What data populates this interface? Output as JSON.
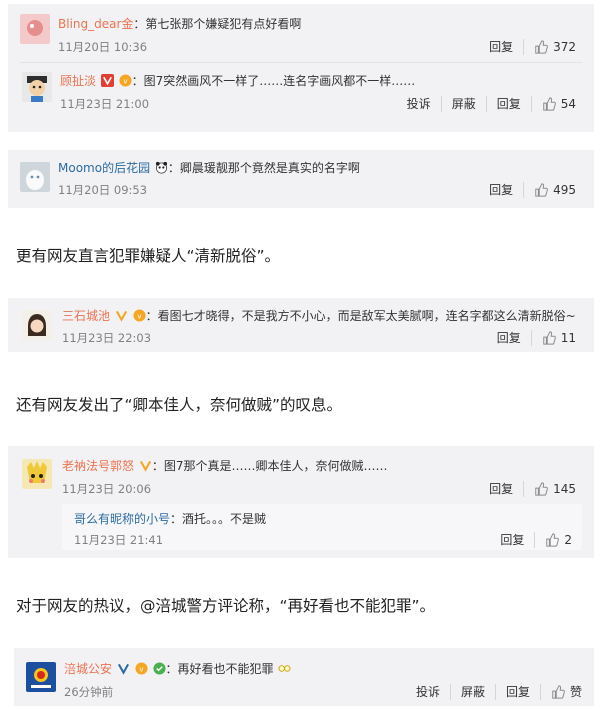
{
  "thread1": {
    "c1": {
      "username": "Bling_dear金",
      "text": "：第七张那个嫌疑犯有点好看啊",
      "time": "11月20日 10:36",
      "reply_label": "回复",
      "likes": "372"
    },
    "c2": {
      "username": "顾扯淡",
      "text": "：图7突然画风不一样了……连名字画风都不一样……",
      "time": "11月23日 21:00",
      "report_label": "投诉",
      "block_label": "屏蔽",
      "reply_label": "回复",
      "likes": "54"
    }
  },
  "thread2": {
    "username": "Moomo的后花园",
    "text": "：卿晨瑗靓那个竟然是真实的名字啊",
    "time": "11月20日 09:53",
    "reply_label": "回复",
    "likes": "495"
  },
  "para1": "更有网友直言犯罪嫌疑人“清新脱俗”。",
  "thread3": {
    "username": "三石城池",
    "text": "：看图七才晓得，不是我方不小心，而是敌军太美腻啊，连名字都这么清新脱俗~",
    "time": "11月23日 22:03",
    "reply_label": "回复",
    "likes": "11"
  },
  "para2": "还有网友发出了“卿本佳人，奈何做贼”的叹息。",
  "thread4": {
    "username": "老衲法号郭怒",
    "text": "：图7那个真是……卿本佳人，奈何做贼……",
    "time": "11月23日 20:06",
    "reply_label": "回复",
    "likes": "145",
    "sub": {
      "username": "哥么有昵称的小号",
      "text": "：酒托。。。不是贼",
      "time": "11月23日 21:41",
      "reply_label": "回复",
      "likes": "2"
    }
  },
  "para3": "对于网友的热议，@涪城警方评论称，“再好看也不能犯罪”。",
  "thread5": {
    "username": "涪城公安",
    "text": "：再好看也不能犯罪",
    "time": "26分钟前",
    "report_label": "投诉",
    "block_label": "屏蔽",
    "reply_label": "回复",
    "likes": "赞"
  },
  "colors": {
    "username": "#eb7350",
    "username_blue": "#2c6ba1",
    "badge_red": "#e33e33",
    "badge_gold": "#f5a623",
    "card_bg": "#f2f2f5"
  },
  "icons": [
    "thumb-up-icon",
    "verified-v-icon",
    "vip-badge-icon",
    "panda-emoji-icon",
    "glasses-emoji-icon",
    "green-badge-icon"
  ]
}
